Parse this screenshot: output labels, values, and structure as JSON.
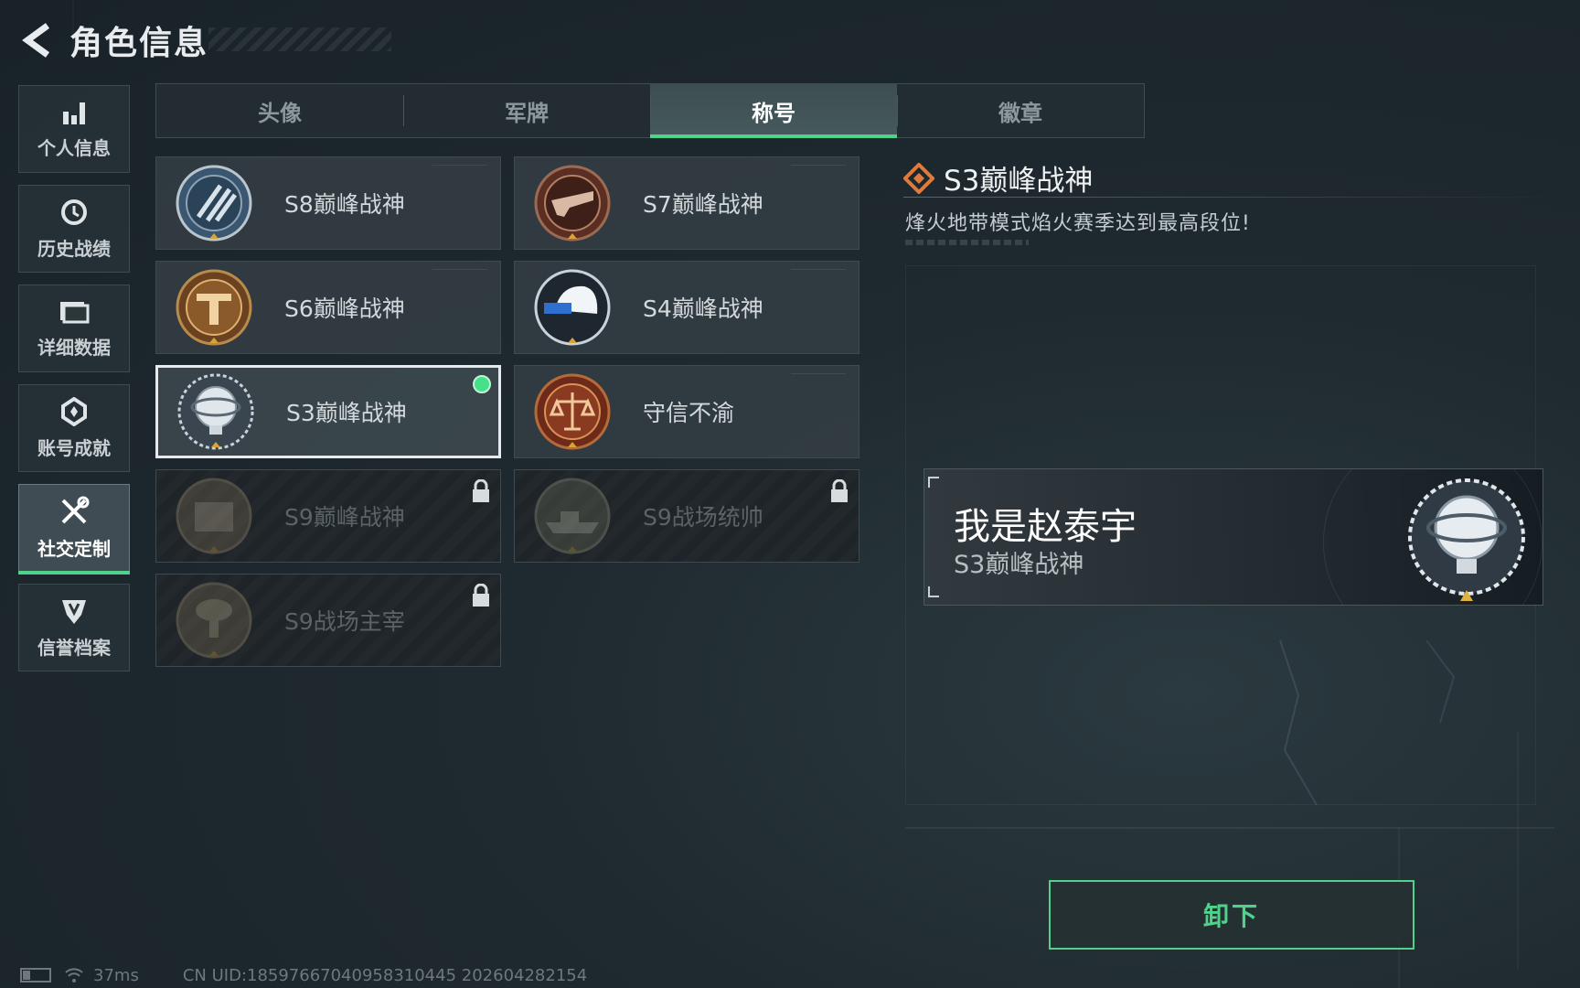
{
  "header": {
    "title": "角色信息"
  },
  "sidebar": {
    "items": [
      {
        "label": "个人信息",
        "icon": "bar-chart-icon",
        "active": false
      },
      {
        "label": "历史战绩",
        "icon": "clock-icon",
        "active": false
      },
      {
        "label": "详细数据",
        "icon": "folder-icon",
        "active": false
      },
      {
        "label": "账号成就",
        "icon": "achievement-icon",
        "active": false
      },
      {
        "label": "社交定制",
        "icon": "tools-icon",
        "active": true
      },
      {
        "label": "信誉档案",
        "icon": "shield-icon",
        "active": false
      }
    ]
  },
  "tabs": [
    {
      "label": "头像",
      "active": false
    },
    {
      "label": "军牌",
      "active": false
    },
    {
      "label": "称号",
      "active": true
    },
    {
      "label": "徽章",
      "active": false
    }
  ],
  "titles": [
    {
      "name": "S8巅峰战神",
      "badge": "s8-emblem-icon",
      "state": "owned"
    },
    {
      "name": "S7巅峰战神",
      "badge": "s7-emblem-icon",
      "state": "owned"
    },
    {
      "name": "S6巅峰战神",
      "badge": "s6-emblem-icon",
      "state": "owned"
    },
    {
      "name": "S4巅峰战神",
      "badge": "s4-emblem-icon",
      "state": "owned"
    },
    {
      "name": "S3巅峰战神",
      "badge": "s3-emblem-icon",
      "state": "equipped"
    },
    {
      "name": "守信不渝",
      "badge": "scales-emblem-icon",
      "state": "owned"
    },
    {
      "name": "S9巅峰战神",
      "badge": "s9-emblem-icon",
      "state": "locked"
    },
    {
      "name": "S9战场统帅",
      "badge": "warship-emblem-icon",
      "state": "locked"
    },
    {
      "name": "S9战场主宰",
      "badge": "mushroom-cloud-emblem-icon",
      "state": "locked"
    }
  ],
  "detail": {
    "title": "S3巅峰战神",
    "description": "烽火地带模式焰火赛季达到最高段位!"
  },
  "nameplate": {
    "player_name": "我是赵泰宇",
    "title": "S3巅峰战神"
  },
  "actions": {
    "unequip_label": "卸下"
  },
  "footer": {
    "ping": "37ms",
    "uid": "CN UID:18597667040958310445 202604282154"
  },
  "colors": {
    "accent": "#4fd38c",
    "detail_icon": "#e07a3c"
  }
}
